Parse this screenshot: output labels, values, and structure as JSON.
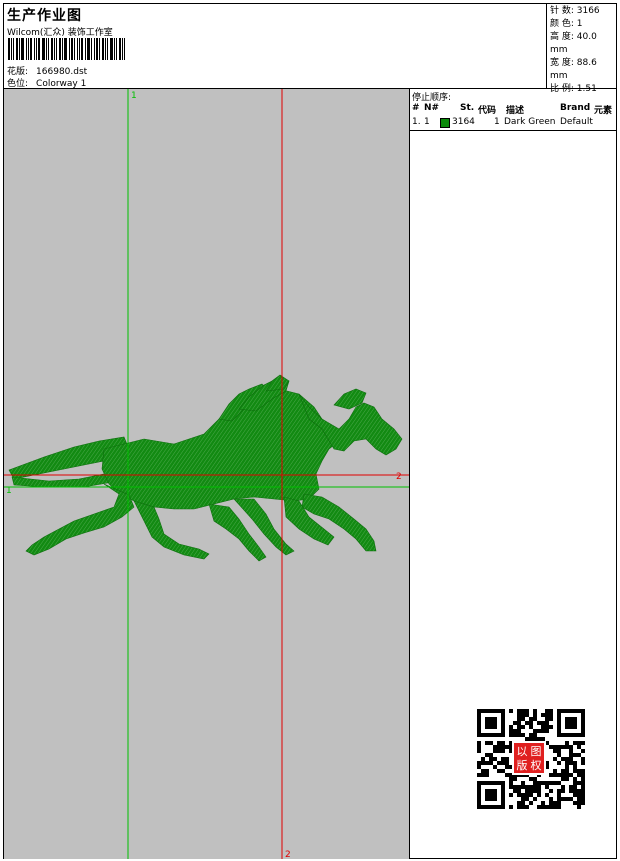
{
  "header": {
    "title": "生产作业图",
    "company": "Wilcom(汇众) 装饰工作室",
    "design_label": "花版:",
    "design_value": "166980.dst",
    "colorway_label": "色位:",
    "colorway_value": "Colorway 1"
  },
  "stats": {
    "stitches": "针 数: 3166",
    "colors": "颜 色: 1",
    "height": "高 度: 40.0 mm",
    "width": "宽 度: 88.6 mm",
    "ratio": "比 例: 1.51"
  },
  "axes": {
    "v_green_top": "1",
    "h_green_left": "1",
    "h_red_right": "2",
    "v_red_bottom": "2",
    "green_color": "#00c000",
    "red_color": "#e00000"
  },
  "design": {
    "background": "#c0c0c0",
    "thread_color": "#128a12"
  },
  "stop_sequence": {
    "label": "停止顺序:",
    "columns": [
      "#",
      "N#",
      "St.",
      "代码",
      "描述",
      "Brand",
      "元素"
    ],
    "rows": [
      {
        "num": "1.",
        "n": "1",
        "stitches": "3164",
        "code": "1",
        "description": "Dark Green",
        "brand": "Default",
        "swatch": "#0a8a0a"
      }
    ]
  },
  "stamp": {
    "text": "以图版权",
    "color": "#e02020"
  }
}
